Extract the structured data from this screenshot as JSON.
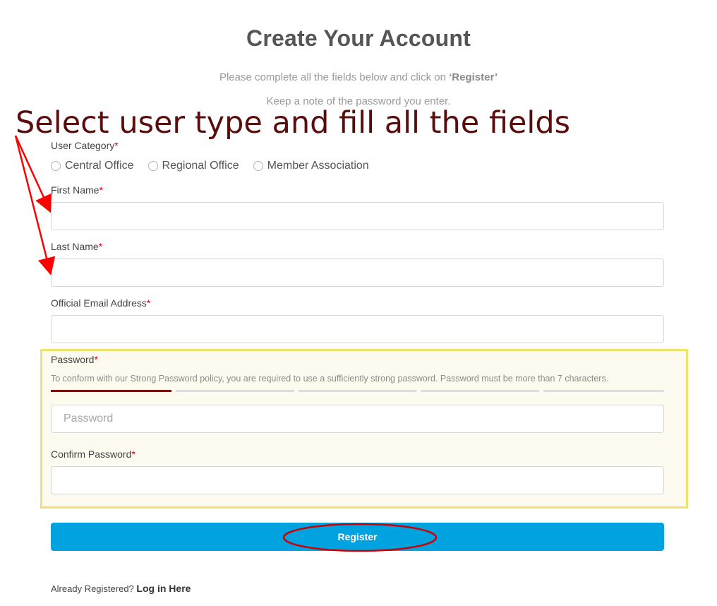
{
  "page": {
    "title": "Create Your Account",
    "subtitle_prefix": "Please complete all the fields below and click on ",
    "subtitle_emphasis": "‘Register’",
    "note": "Keep a note of the password you enter."
  },
  "annotation": {
    "text": "Select user type and fill all the fields",
    "color": "#5a0d0d",
    "arrow_color": "#ff0000",
    "highlight_color": "#f2e26a"
  },
  "form": {
    "required_marker": "*",
    "user_category": {
      "label": "User Category",
      "options": [
        "Central Office",
        "Regional Office",
        "Member Association"
      ]
    },
    "first_name": {
      "label": "First Name",
      "value": ""
    },
    "last_name": {
      "label": "Last Name",
      "value": ""
    },
    "email": {
      "label": "Official Email Address",
      "value": ""
    },
    "password": {
      "label": "Password",
      "hint": "To conform with our Strong Password policy, you are required to use a sufficiently strong password. Password must be more than 7 characters.",
      "placeholder": "Password",
      "strength_level": 1,
      "strength_segments": 5,
      "strength_color": "#7a0c0c"
    },
    "confirm_password": {
      "label": "Confirm Password",
      "value": ""
    },
    "register_label": "Register",
    "register_color": "#00a3e0"
  },
  "footer": {
    "text": "Already Registered?",
    "link": "Log in Here"
  }
}
